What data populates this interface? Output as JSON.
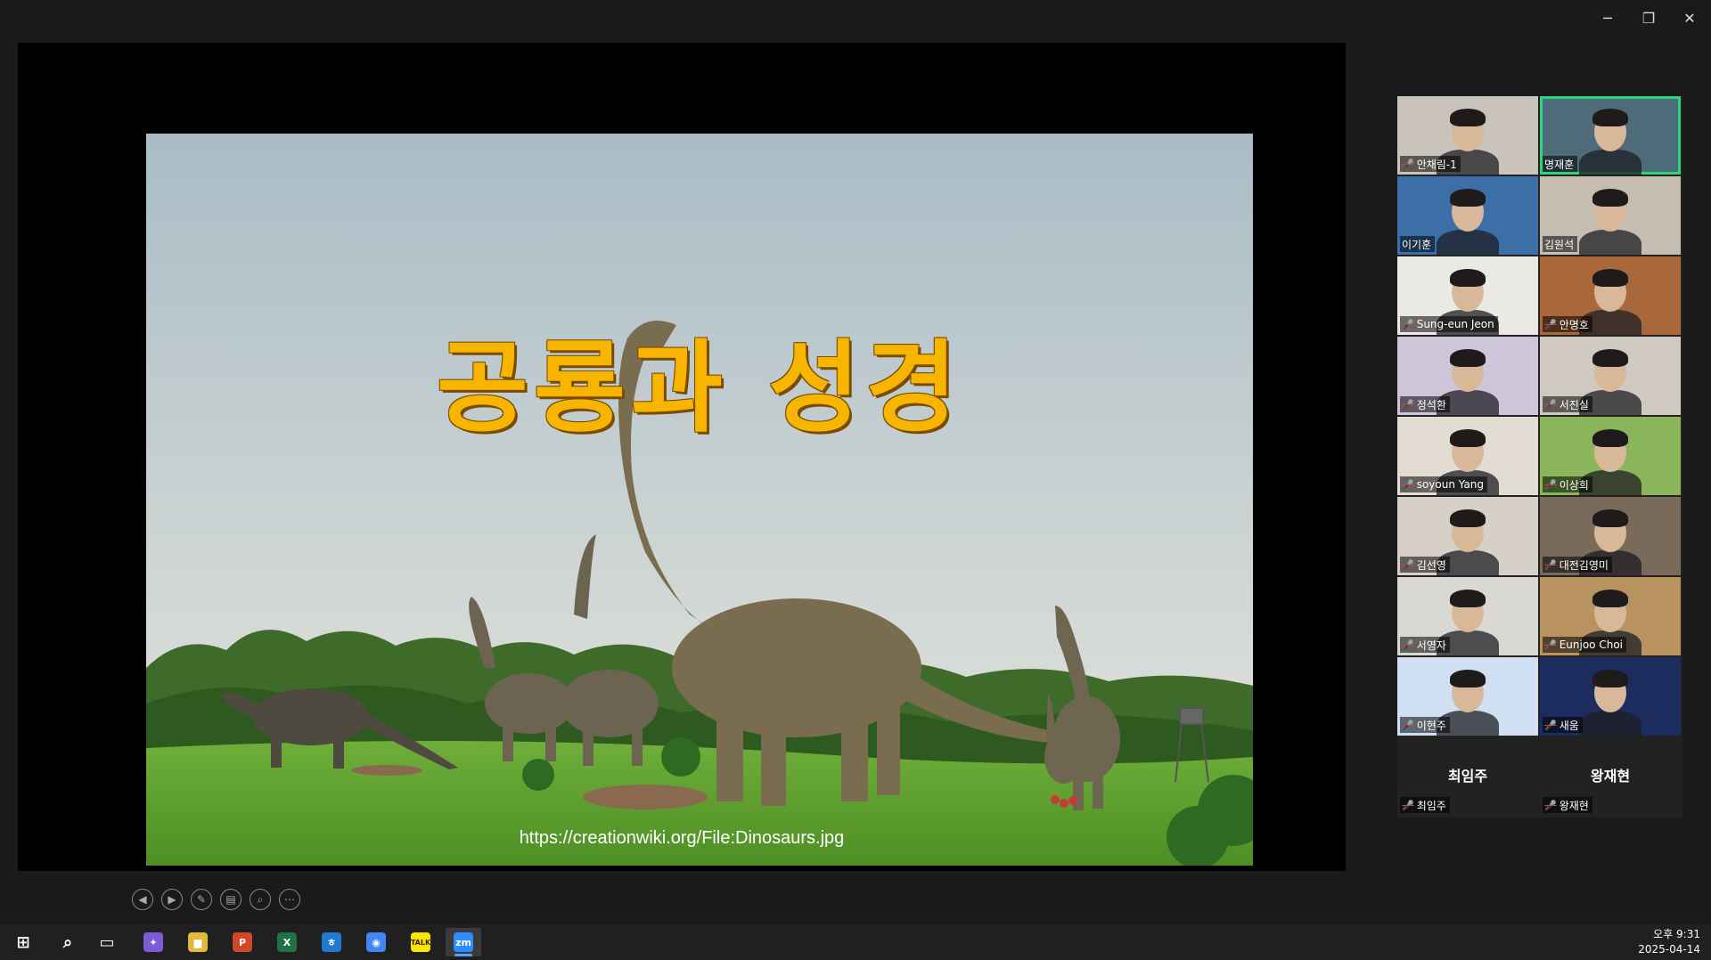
{
  "window": {
    "minimize_glyph": "─",
    "restore_glyph": "❐",
    "close_glyph": "✕"
  },
  "slide": {
    "title": "공룡과 성경",
    "source_url": "https://creationwiki.org/File:Dinosaurs.jpg",
    "controls": [
      "previous-slide",
      "next-slide",
      "annotate-pen",
      "slide-overview",
      "zoom",
      "more-options"
    ]
  },
  "gallery": {
    "participants": [
      {
        "name": "안채림-1",
        "muted": true,
        "video": true,
        "bg": "#c9c3bb"
      },
      {
        "name": "명재훈",
        "muted": false,
        "video": true,
        "active": true,
        "bg": "#4d6b78"
      },
      {
        "name": "이기훈",
        "muted": false,
        "video": true,
        "bg": "#3c6fa8"
      },
      {
        "name": "김원석",
        "muted": false,
        "video": true,
        "bg": "#c5bdb0"
      },
      {
        "name": "Sung-eun Jeon",
        "muted": true,
        "video": true,
        "bg": "#ebe9e4"
      },
      {
        "name": "안명호",
        "muted": true,
        "video": true,
        "bg": "#a8683c"
      },
      {
        "name": "정석환",
        "muted": true,
        "video": true,
        "bg": "#cfc5d8"
      },
      {
        "name": "서진실",
        "muted": true,
        "video": true,
        "bg": "#cfc9c2"
      },
      {
        "name": "soyoun Yang",
        "muted": true,
        "video": true,
        "bg": "#e2dcd2"
      },
      {
        "name": "이상희",
        "muted": true,
        "video": true,
        "bg": "#8ab55a"
      },
      {
        "name": "김선영",
        "muted": true,
        "video": true,
        "bg": "#d7d0c6"
      },
      {
        "name": "대전김영미",
        "muted": true,
        "video": true,
        "bg": "#7a6a5a"
      },
      {
        "name": "서영자",
        "muted": true,
        "video": true,
        "bg": "#dad8d2"
      },
      {
        "name": "Eunjoo Choi",
        "muted": true,
        "video": true,
        "bg": "#b8935f"
      },
      {
        "name": "이현주",
        "muted": true,
        "video": true,
        "bg": "#cfe0f2"
      },
      {
        "name": "새움",
        "muted": true,
        "video": true,
        "bg": "#1d2c5e"
      },
      {
        "name": "최임주",
        "muted": true,
        "video": false,
        "display_name": "최임주"
      },
      {
        "name": "왕재현",
        "muted": true,
        "video": false,
        "display_name": "왕재현"
      }
    ]
  },
  "taskbar": {
    "apps": [
      {
        "name": "start",
        "label": "⊞"
      },
      {
        "name": "search",
        "label": "⌕"
      },
      {
        "name": "task-view",
        "label": "▭"
      },
      {
        "name": "copilot",
        "label": "✦"
      },
      {
        "name": "file-explorer",
        "label": "▆"
      },
      {
        "name": "powerpoint",
        "label": "P"
      },
      {
        "name": "excel",
        "label": "X"
      },
      {
        "name": "hancom",
        "label": "ㅎ"
      },
      {
        "name": "chrome",
        "label": "◉"
      },
      {
        "name": "kakaotalk",
        "label": "TALK"
      },
      {
        "name": "zoom",
        "label": "zm"
      }
    ],
    "time": "오후 9:31",
    "date": "2025-04-14"
  },
  "colors": {
    "accent_active": "#2fd57b",
    "mute_red": "#e23b3b",
    "title_yellow": "#f7b500"
  }
}
